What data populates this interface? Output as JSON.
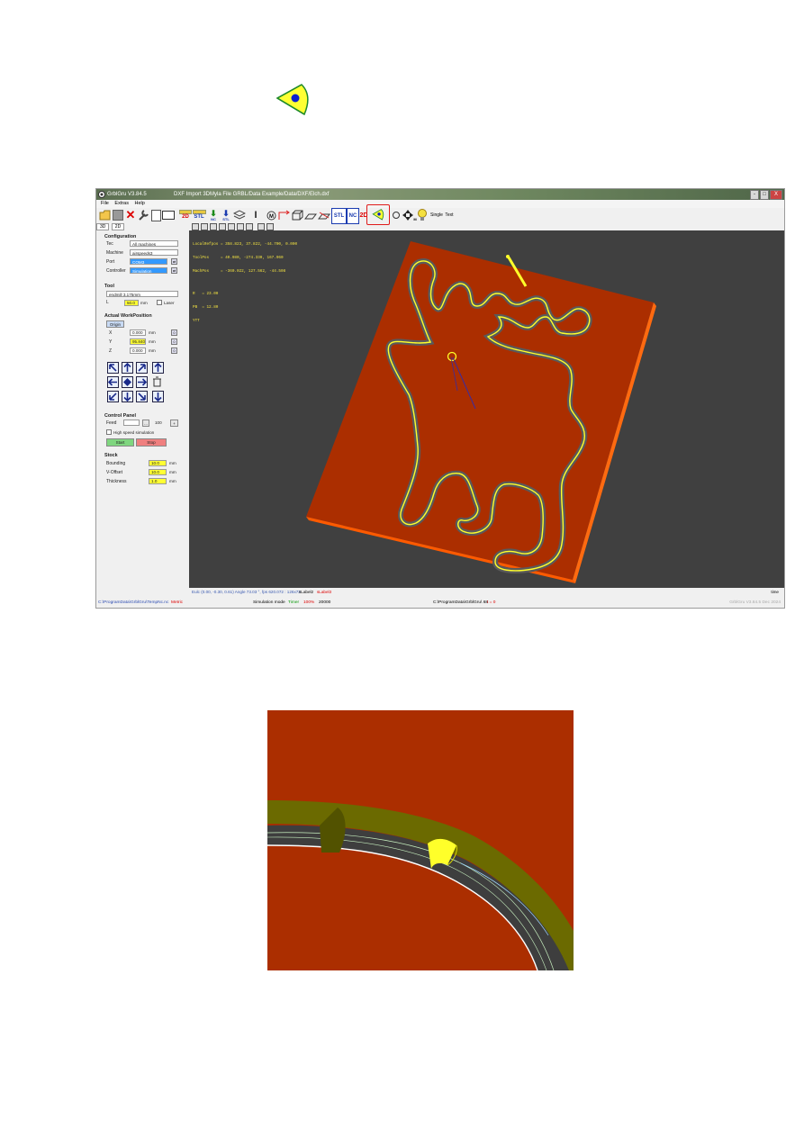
{
  "app": {
    "title": "GrblGru V3.84.5",
    "title_extra": "DXF Import 3D",
    "title_path": "Myla File GRBL/Data Example/Data/DXF/Elch.dxf",
    "window_controls": [
      "-",
      "□",
      "X"
    ],
    "menu": [
      "File",
      "Extras",
      "Help"
    ],
    "toolbar": {
      "label_2d": "2D",
      "label_stl": "STL",
      "label_nc": "NC",
      "label_nc_small": "NC",
      "label_stl_small": "STL",
      "label_stl2": "STL",
      "label_nc2": "NC",
      "label_2d_red": "2D",
      "label_m": "M",
      "label_single": "Single",
      "label_text": "Text"
    },
    "tabs": [
      "3D",
      "2D"
    ]
  },
  "panel": {
    "configuration": {
      "title": "Configuration",
      "tec_label": "Tec",
      "tec_value": "All machines",
      "machine_label": "Machine",
      "machine_value": "airspeeds3",
      "port_label": "Port",
      "port_value": "COM3",
      "controller_label": "Controller",
      "controller_value": "Simulation"
    },
    "tool": {
      "title": "Tool",
      "tool_value": "endmill 3.175mm",
      "length_label": "L",
      "length_value": "50.0",
      "unit": "mm",
      "laser_label": "Laser"
    },
    "workpos": {
      "title": "Actual WorkPosition",
      "origin_label": "Origin",
      "x_label": "X",
      "x_value": "0.000",
      "y_label": "Y",
      "y_value": "95.840",
      "z_label": "Z",
      "z_value": "0.000",
      "unit": "mm",
      "zero_label": "0"
    },
    "control": {
      "title": "Control Panel",
      "feed_label": "Feed",
      "feed_btn": "...",
      "feed_value": "100",
      "feed_plus": "+",
      "hss_label": "High speed simulation",
      "start_label": "Start",
      "stop_label": "Stop"
    },
    "stock": {
      "title": "Stock",
      "bounding_label": "Bounding",
      "bounding_value": "10.0",
      "voffset_label": "V-Offset",
      "voffset_value": "10.0",
      "thickness_label": "Thickness",
      "thickness_value": "1.0",
      "unit": "mm"
    }
  },
  "view": {
    "overlay_lines": [
      "LocalRefpos = 358.823, 37.822, -44.700, 0.000",
      "ToolPos     = 40.980, -274.330, 167.960",
      "MachPos     = -360.022, 127.562, -44.508",
      "",
      "R   = 23.00",
      "PB  = 12.80",
      "YTT"
    ]
  },
  "status": {
    "left": "Eulc (0.00, -0.30, 0.61) Angle 73.03 °, fps 620.072 : 126x72",
    "label2": "sLabel2",
    "label3": "sLabel3",
    "time": "time"
  },
  "bottombar": {
    "path": "C:\\ProgramData\\GrblGru\\TempNc.nc",
    "metric": "Metric",
    "simulation": "Simulation mode",
    "timer": "Timer",
    "percent": "100%",
    "count": "20000",
    "data_path": "C:\\ProgramData\\GrblGru\\ 68",
    "t_value": "t = 0",
    "version": "GrblGru V3.84.5 Dec 2024"
  },
  "colors": {
    "stock": "#ab2e00",
    "viewport": "#404040",
    "path_yellow": "#ffff2a",
    "highlight_red": "#e01b1b"
  }
}
